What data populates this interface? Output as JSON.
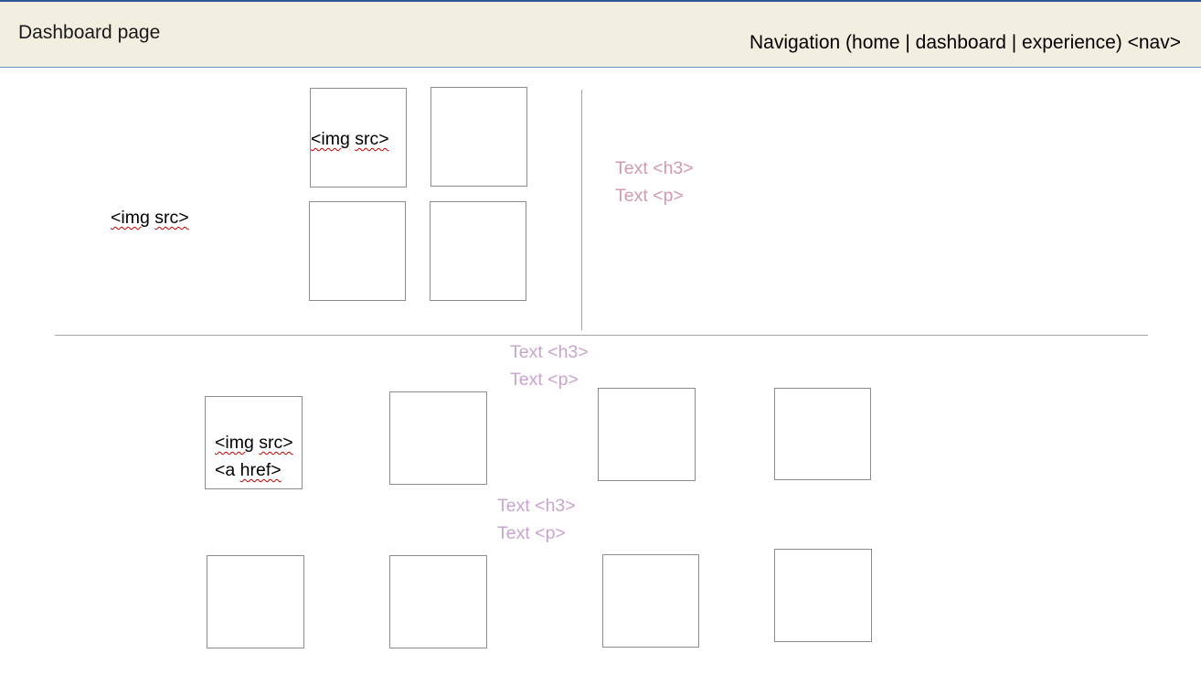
{
  "header": {
    "title": "Dashboard page",
    "nav_text": "Navigation (home | dashboard | experience) <nav>",
    "background": "#f2eee0",
    "border_color": "#2f5597"
  },
  "labels": {
    "img_open": "<img",
    "src": "src>",
    "a_open": "<a",
    "href": "href>"
  },
  "text_blocks": {
    "top": {
      "h3": "Text <h3>",
      "p": "Text <p>",
      "color": "#d39aa9"
    },
    "middle": {
      "h3": "Text <h3>",
      "p": "Text <p>",
      "color": "#c8a4cf"
    },
    "bottom": {
      "h3": "Text <h3>",
      "p": "Text <p>",
      "color": "#c8a4cf"
    }
  }
}
